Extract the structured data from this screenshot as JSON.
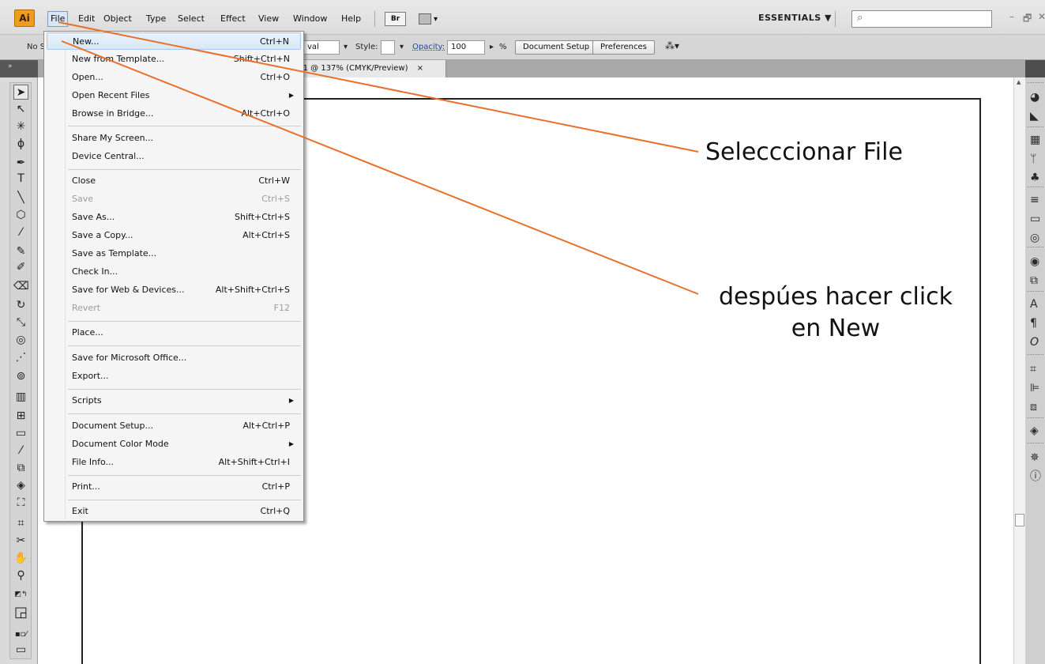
{
  "app": {
    "logo": "Ai"
  },
  "menubar": {
    "items": [
      "File",
      "Edit",
      "Object",
      "Type",
      "Select",
      "Effect",
      "View",
      "Window",
      "Help"
    ],
    "bridge_label": "Br",
    "workspace": "ESSENTIALS ▼",
    "search_glyph": "⌕",
    "window_controls": [
      "–",
      "🗗",
      "✕"
    ]
  },
  "controlbar": {
    "selection_label": "No S",
    "shape_value": "val",
    "style_label": "Style:",
    "opacity_label": "Opacity:",
    "opacity_value": "100",
    "percent": "%",
    "document_setup": "Document Setup",
    "preferences": "Preferences"
  },
  "document_tab": {
    "label": "-1 @ 137% (CMYK/Preview)",
    "close": "×"
  },
  "file_menu": {
    "items": [
      {
        "label": "New...",
        "shortcut": "Ctrl+N",
        "highlighted": true
      },
      {
        "label": "New from Template...",
        "shortcut": "Shift+Ctrl+N"
      },
      {
        "label": "Open...",
        "shortcut": "Ctrl+O"
      },
      {
        "label": "Open Recent Files",
        "shortcut": "",
        "submenu": true
      },
      {
        "label": "Browse in Bridge...",
        "shortcut": "Alt+Ctrl+O"
      },
      {
        "label": "Share My Screen...",
        "shortcut": ""
      },
      {
        "label": "Device Central...",
        "shortcut": ""
      },
      {
        "label": "Close",
        "shortcut": "Ctrl+W"
      },
      {
        "label": "Save",
        "shortcut": "Ctrl+S",
        "disabled": true
      },
      {
        "label": "Save As...",
        "shortcut": "Shift+Ctrl+S"
      },
      {
        "label": "Save a Copy...",
        "shortcut": "Alt+Ctrl+S"
      },
      {
        "label": "Save as Template...",
        "shortcut": ""
      },
      {
        "label": "Check In...",
        "shortcut": ""
      },
      {
        "label": "Save for Web & Devices...",
        "shortcut": "Alt+Shift+Ctrl+S"
      },
      {
        "label": "Revert",
        "shortcut": "F12",
        "disabled": true
      },
      {
        "label": "Place...",
        "shortcut": ""
      },
      {
        "label": "Save for Microsoft Office...",
        "shortcut": ""
      },
      {
        "label": "Export...",
        "shortcut": ""
      },
      {
        "label": "Scripts",
        "shortcut": "",
        "submenu": true
      },
      {
        "label": "Document Setup...",
        "shortcut": "Alt+Ctrl+P"
      },
      {
        "label": "Document Color Mode",
        "shortcut": "",
        "submenu": true
      },
      {
        "label": "File Info...",
        "shortcut": "Alt+Shift+Ctrl+I"
      },
      {
        "label": "Print...",
        "shortcut": "Ctrl+P"
      },
      {
        "label": "Exit",
        "shortcut": "Ctrl+Q"
      }
    ]
  },
  "annotations": {
    "step1": "Selecccionar File",
    "step2": "despúes hacer click en New",
    "line_color": "#e8702a"
  },
  "colors": {
    "accent": "#ef9b1d",
    "menu_highlight": "#d8e7f7"
  }
}
